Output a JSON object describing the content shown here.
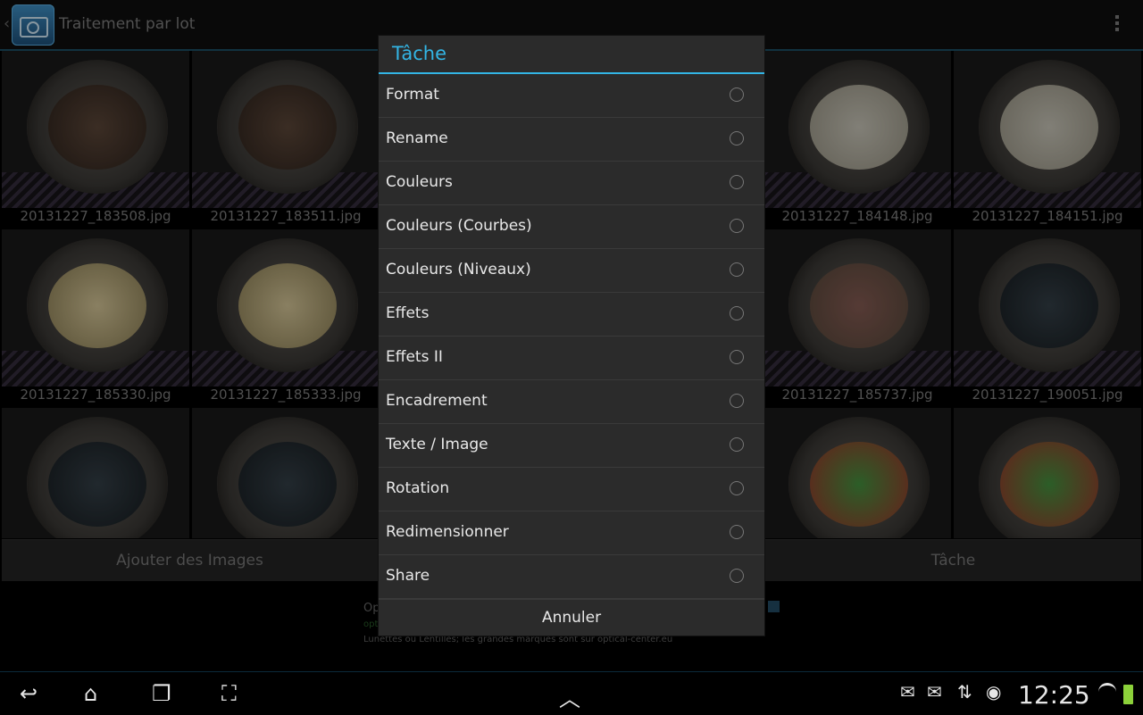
{
  "action_bar": {
    "title": "Traitement par lot",
    "app_icon": "camera-batch-icon",
    "back_icon": "chevron-left-icon",
    "overflow_icon": "overflow-menu-icon"
  },
  "grid": {
    "rows": [
      [
        "20131227_183508.jpg",
        "20131227_183511.jpg",
        "20131227_184148.jpg",
        "20131227_184151.jpg"
      ],
      [
        "20131227_185330.jpg",
        "20131227_185333.jpg",
        "20131227_185737.jpg",
        "20131227_190051.jpg"
      ],
      [
        "",
        "",
        "",
        ""
      ]
    ]
  },
  "buttons": {
    "add_images": "Ajouter des Images",
    "task": "Tâche"
  },
  "ad": {
    "line1": "Op",
    "line2": "opt",
    "line3": "Lunettes ou Lentilles; les grandes marques sont sur optical-center.eu"
  },
  "dialog": {
    "title": "Tâche",
    "options": [
      "Format",
      "Rename",
      "Couleurs",
      "Couleurs (Courbes)",
      "Couleurs (Niveaux)",
      "Effets",
      "Effets II",
      "Encadrement",
      "Texte / Image",
      "Rotation",
      "Redimensionner",
      "Share"
    ],
    "cancel_label": "Annuler"
  },
  "system_bar": {
    "time": "12:25",
    "nav_icons": [
      "back-icon",
      "home-icon",
      "recent-apps-icon",
      "screenshot-icon"
    ],
    "status_icons": [
      "email-icon",
      "mail-at-icon",
      "sync-icon",
      "notification-icon",
      "wifi-icon",
      "battery-icon"
    ]
  },
  "colors": {
    "accent": "#33b5e5",
    "dialog_bg": "#2b2b2b",
    "battery": "#8cd13a"
  }
}
